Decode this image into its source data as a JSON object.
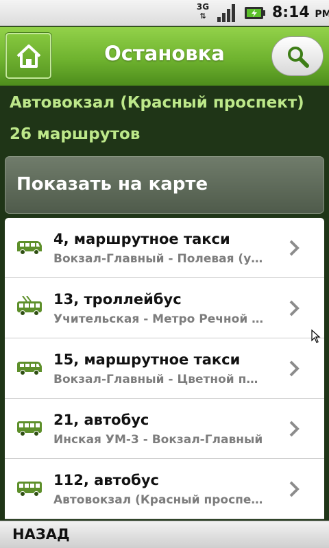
{
  "status_bar": {
    "network": "3G",
    "network_arrows": "⇅",
    "time": "8:14",
    "ampm": "PM"
  },
  "header": {
    "title": "Остановка"
  },
  "stop": {
    "name": "Автовокзал (Красный проспект)",
    "routes_count": "26 маршрутов"
  },
  "map_button": {
    "label": "Показать на карте"
  },
  "routes": [
    {
      "title": "4, маршрутное такси",
      "description": "Вокзал-Главный - Полевая (ул. Полевая)",
      "icon": "minibus-icon"
    },
    {
      "title": "13, троллейбус",
      "description": "Учительская - Метро Речной вокзал",
      "icon": "trolleybus-icon"
    },
    {
      "title": "15, маршрутное такси",
      "description": "Вокзал-Главный - Цветной проезд",
      "icon": "minibus-icon"
    },
    {
      "title": "21, автобус",
      "description": "Инская УМ-3 - Вокзал-Главный",
      "icon": "bus-icon"
    },
    {
      "title": "112, автобус",
      "description": "Автовокзал (Красный проспект) - Пашино",
      "icon": "bus-icon"
    }
  ],
  "bottom_bar": {
    "back_label": "НАЗАД"
  },
  "colors": {
    "header_green": "#6fb32f",
    "accent_text": "#bde88a",
    "background": "#1f3517",
    "icon_green": "#4f7f1f"
  }
}
